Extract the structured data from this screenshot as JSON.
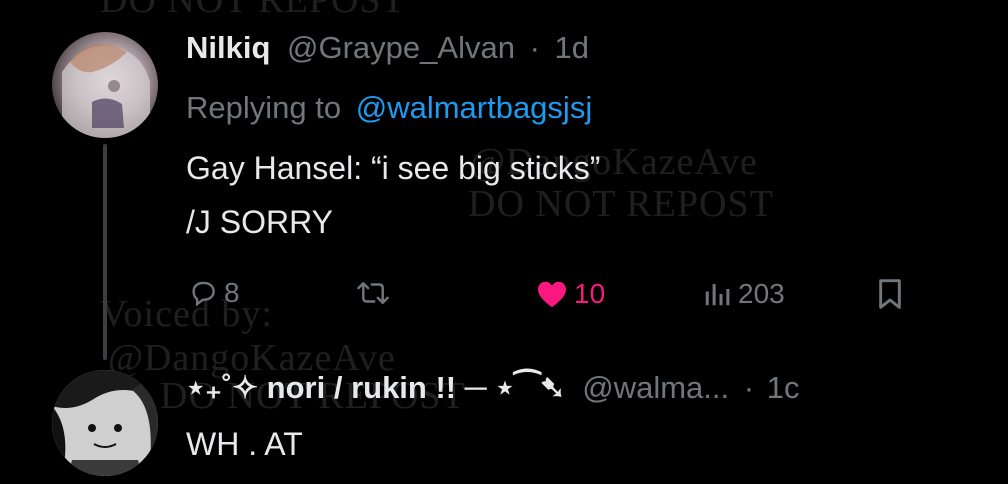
{
  "watermark": {
    "voiced_by": "Voiced by:",
    "handle": "@DangoKazeAve",
    "do_not_repost": "DO NOT REPOST",
    "handle_partial": "@DangoKazeAve"
  },
  "reply1": {
    "display_name": "Nilkiq",
    "handle": "@Graype_Alvan",
    "separator": "·",
    "time": "1d",
    "replying_to_label": "Replying to",
    "replying_to_handle": "@walmartbagsjsj",
    "text_line1": "Gay Hansel: “i see big sticks”",
    "text_line2": "/J SORRY",
    "actions": {
      "replies": "8",
      "reposts": "",
      "likes": "10",
      "views": "203"
    }
  },
  "reply2": {
    "display_name": "⋆₊˚✧ nori / rukin !! ─  ⋆⁀➷",
    "handle": "@walma...",
    "separator": "·",
    "time": "1c",
    "text": "WH . AT"
  },
  "colors": {
    "background": "#000000",
    "text": "#e7e9ea",
    "muted": "#71767b",
    "link": "#1d9bf0",
    "like": "#f91880"
  }
}
